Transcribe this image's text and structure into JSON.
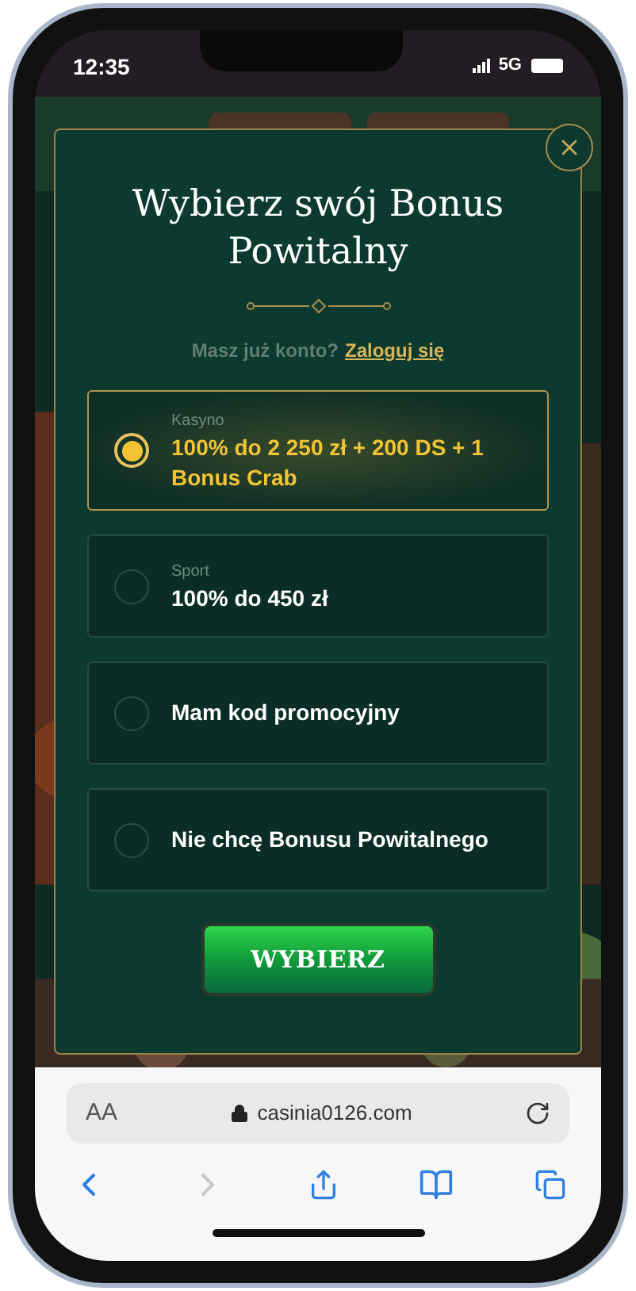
{
  "status_bar": {
    "time": "12:35",
    "network": "5G"
  },
  "modal": {
    "title": "Wybierz swój Bonus Powitalny",
    "login_prompt": "Masz już konto?",
    "login_link": "Zaloguj się",
    "options": [
      {
        "category": "Kasyno",
        "label": "100% do 2 250 zł + 200 DS + 1 Bonus Crab",
        "selected": true
      },
      {
        "category": "Sport",
        "label": "100% do 450 zł",
        "selected": false
      },
      {
        "label": "Mam kod promocyjny",
        "selected": false
      },
      {
        "label": "Nie chcę Bonusu Powitalnego",
        "selected": false
      }
    ],
    "submit": "WYBIERZ"
  },
  "browser": {
    "text_size": "AA",
    "url": "casinia0126.com",
    "forward_disabled": true
  }
}
